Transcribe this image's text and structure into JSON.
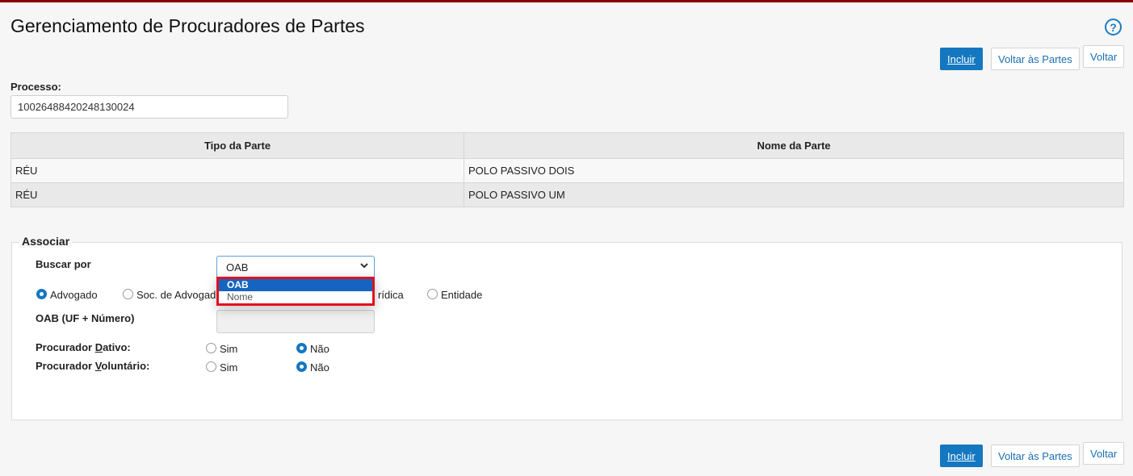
{
  "page": {
    "title": "Gerenciamento de Procuradores de Partes",
    "help_icon": "?"
  },
  "toolbar": {
    "incluir": "Incluir",
    "voltar_partes": "Voltar às Partes",
    "voltar": "Voltar"
  },
  "processo": {
    "label": "Processo:",
    "value": "10026488420248130024"
  },
  "table": {
    "columns": [
      "Tipo da Parte",
      "Nome da Parte"
    ],
    "rows": [
      [
        "RÉU",
        "POLO PASSIVO DOIS"
      ],
      [
        "RÉU",
        "POLO PASSIVO UM"
      ]
    ]
  },
  "associar": {
    "legend": "Associar",
    "buscar_por_label": "Buscar por",
    "buscar_por_value": "OAB",
    "dropdown_options": [
      "OAB",
      "Nome"
    ],
    "radio_tipos": [
      "Advogado",
      "Soc. de Advogad",
      "rídica",
      "Entidade"
    ],
    "oab_label": "OAB (UF + Número)",
    "dativo_label": "Procurador Dativo:",
    "voluntario_label": "Procurador Voluntário:",
    "sim": "Sim",
    "nao": "Não"
  },
  "colors": {
    "accent": "#1477c0",
    "topbar": "#8b0000",
    "highlight_border": "#e01020"
  }
}
